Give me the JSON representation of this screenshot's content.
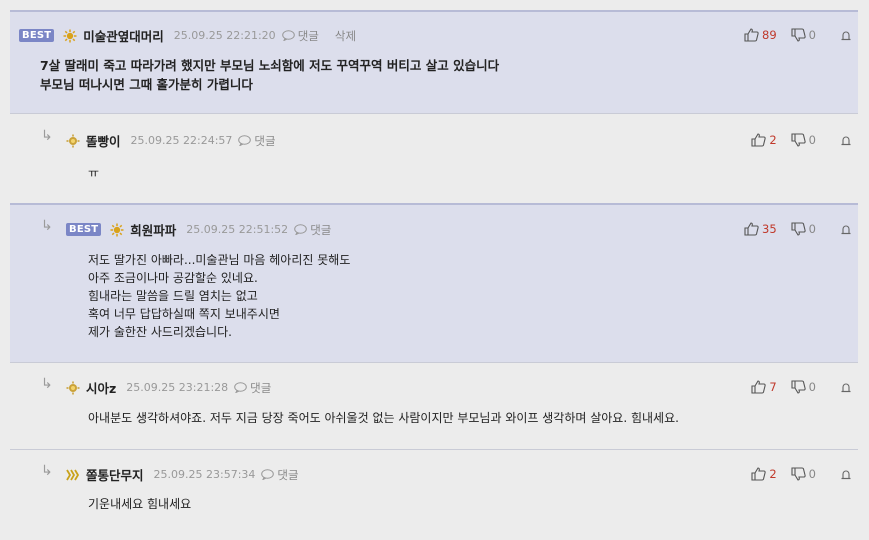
{
  "comments": [
    {
      "best": true,
      "badge": "BEST",
      "nick": "미술관옆대머리",
      "time": "25.09.25 22:21:20",
      "reply": "댓글",
      "delete": "삭제",
      "up": "89",
      "down": "0",
      "lines": [
        "7살 딸래미 죽고 따라가려 했지만 부모님 노쇠함에 저도 꾸역꾸역 버티고 살고 있습니다",
        "부모님 떠나시면 그때 홀가분히 가렵니다"
      ]
    },
    {
      "best": false,
      "nick": "똘빵이",
      "time": "25.09.25 22:24:57",
      "reply": "댓글",
      "up": "2",
      "down": "0",
      "lines": [
        "ㅠ"
      ]
    },
    {
      "best": true,
      "badge": "BEST",
      "nick": "희원파파",
      "time": "25.09.25 22:51:52",
      "reply": "댓글",
      "up": "35",
      "down": "0",
      "lines": [
        "저도 딸가진 아빠라...미술관님 마음 헤아리진 못해도",
        "아주 조금이나마 공감할순 있네요.",
        "힘내라는 말씀을 드릴 염치는 없고",
        "혹여 너무 답답하실때 쪽지 보내주시면",
        "제가 술한잔 사드리겠습니다."
      ]
    },
    {
      "best": false,
      "nick": "시아z",
      "time": "25.09.25 23:21:28",
      "reply": "댓글",
      "up": "7",
      "down": "0",
      "lines": [
        "아내분도 생각하셔야죠. 저두 지금 당장 죽어도 아쉬울것 없는 사람이지만 부모님과 와이프 생각하며 살아요. 힘내세요."
      ]
    },
    {
      "best": false,
      "nick": "쫄통단무지",
      "time": "25.09.25 23:57:34",
      "reply": "댓글",
      "up": "2",
      "down": "0",
      "lines": [
        "기운내세요 힘내세요"
      ]
    }
  ],
  "icons": {
    "reply": "speech-bubble-icon",
    "up": "thumbs-up-icon",
    "down": "thumbs-down-icon",
    "report": "siren-icon",
    "arrow": "reply-arrow-icon"
  },
  "colors": {
    "best_bg": "#dcdeec",
    "badge": "#7b86c6",
    "up_count": "#c0392b"
  }
}
